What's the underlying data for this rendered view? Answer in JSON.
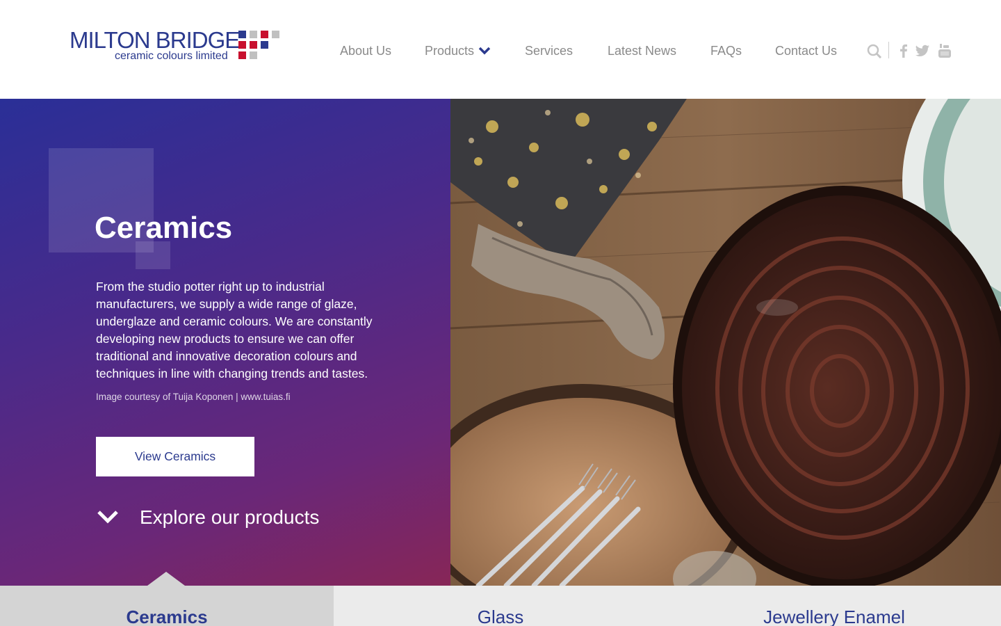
{
  "brand": {
    "name": "MILTON BRIDGE",
    "tagline": "ceramic colours limited",
    "primary_color": "#2b3a8e",
    "accent_red": "#c8102e",
    "accent_grey": "#c0c0c0"
  },
  "nav": {
    "items": [
      {
        "label": "About Us"
      },
      {
        "label": "Products",
        "has_dropdown": true,
        "icon": "chevron-down-icon"
      },
      {
        "label": "Services"
      },
      {
        "label": "Latest News"
      },
      {
        "label": "FAQs"
      },
      {
        "label": "Contact Us"
      }
    ],
    "tools": [
      "search-icon",
      "facebook-icon",
      "twitter-icon",
      "youtube-icon"
    ]
  },
  "hero": {
    "title": "Ceramics",
    "body": "From the studio potter right up to industrial manufacturers, we supply a wide range of glaze, underglaze and ceramic colours. We are constantly developing new products to ensure we can offer traditional and innovative decoration colours and techniques in line with changing trends and tastes.",
    "credit": "Image courtesy of Tuija Koponen | www.tuias.fi",
    "cta_label": "View Ceramics",
    "explore_label": "Explore our products",
    "gradient_colors": [
      "#2a2f97",
      "#872657"
    ]
  },
  "tabs": [
    {
      "label": "Ceramics",
      "active": true
    },
    {
      "label": "Glass",
      "active": false
    },
    {
      "label": "Jewellery Enamel",
      "active": false
    }
  ]
}
